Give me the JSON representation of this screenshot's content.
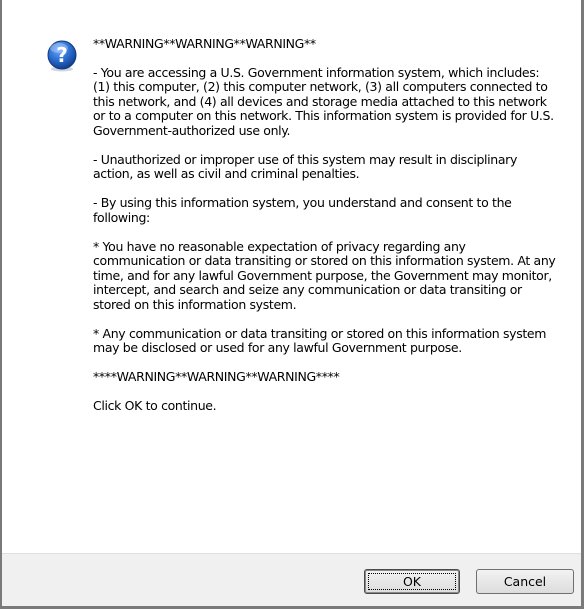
{
  "dialog": {
    "icon": "question-mark-icon",
    "paragraphs": [
      "**WARNING**WARNING**WARNING**",
      "- You are accessing a U.S. Government information system, which includes: (1) this computer, (2) this computer network, (3) all computers connected to this network, and (4) all devices and storage media attached to this network or to a computer on this network. This information system is provided for U.S. Government-authorized use only.",
      "- Unauthorized or improper use of this system may result in disciplinary action, as well as civil and criminal penalties.",
      "- By using this information system, you understand and consent to the following:",
      "* You have no reasonable expectation of privacy regarding any communication or data transiting or stored on this information system. At any time, and for any lawful Government purpose, the Government may monitor, intercept, and search and seize any communication or data transiting or stored on this information system.",
      "* Any communication or data transiting or stored on this information system may be disclosed or used for any lawful Government purpose.",
      "****WARNING**WARNING**WARNING****",
      "Click OK to continue."
    ]
  },
  "buttons": {
    "ok_label": "OK",
    "cancel_label": "Cancel"
  },
  "colors": {
    "icon_blue": "#1f5fb8",
    "footer": "#f0f0f0"
  }
}
